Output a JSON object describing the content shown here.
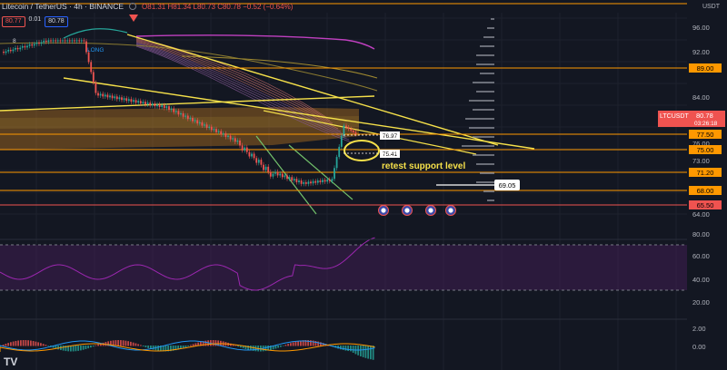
{
  "header": {
    "symbol": "Litecoin / TetherUS · 4h · BINANCE",
    "ohlc": "O81.31 H81.34 L80.73 C80.78 −0.52 (−0.64%)",
    "bid": "80.77",
    "spread": "0.01",
    "ask": "80.78",
    "currency": "USDT"
  },
  "colors": {
    "background": "#131722",
    "grid": "#1e222d",
    "up": "#26a69a",
    "down": "#ef5350",
    "level": "#ff9800",
    "trendline": "#f5e04a",
    "channel": "#72c16b",
    "ma": "#c040c0",
    "rsi": "#9c27b0",
    "macd_line": "#2196f3",
    "signal_line": "#ff9800",
    "price_tag": "#ef5350"
  },
  "chart_data": {
    "type": "candlestick",
    "price_axis_ticks": [
      "96.00",
      "92.00",
      "89.00",
      "84.00",
      "80.78",
      "77.50",
      "76.00",
      "75.00",
      "73.00",
      "71.20",
      "68.00",
      "65.50",
      "64.00"
    ],
    "levels": [
      {
        "price": 89.0,
        "label": "89.00"
      },
      {
        "price": 77.5,
        "label": "77.50"
      },
      {
        "price": 75.0,
        "label": "75.00"
      },
      {
        "price": 71.2,
        "label": "71.20"
      },
      {
        "price": 68.0,
        "label": "68.00"
      },
      {
        "price": 65.5,
        "label": "65.50"
      }
    ],
    "current_price": "80.78",
    "current_symbol": "LTCUSDT",
    "countdown": "03:26:18",
    "annotation": "retest support level",
    "marker_price": "69.05",
    "long_label": "LONG",
    "small_labels": [
      "76.97",
      "75.41"
    ],
    "tag_8": "8",
    "rsi": {
      "ticks": [
        "80.00",
        "60.00",
        "40.00",
        "20.00"
      ],
      "upper": 70,
      "lower": 30
    },
    "macd": {
      "ticks": [
        "2.00",
        "0.00"
      ]
    }
  },
  "toolbar": {
    "logo": "TV"
  }
}
